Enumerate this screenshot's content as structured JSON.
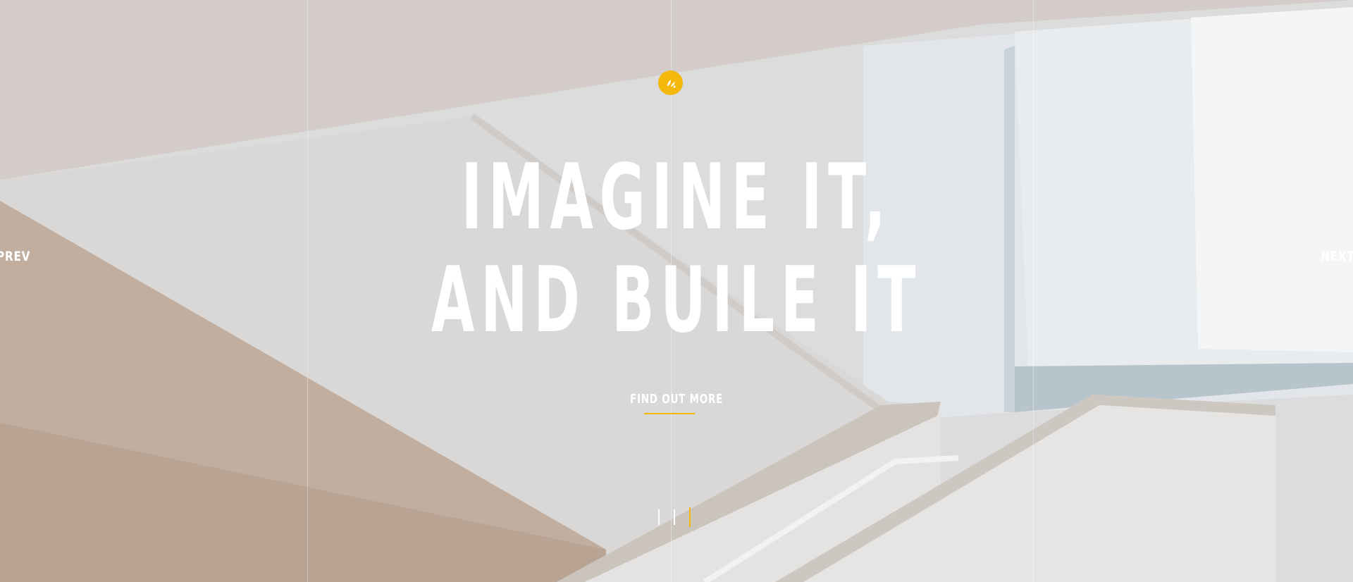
{
  "hero": {
    "headline_line1": "IMAGINE IT,",
    "headline_line2": "AND BUILE IT",
    "cta_label": "FIND OUT MORE"
  },
  "nav": {
    "prev_label": "PREV",
    "next_label": "NEXT"
  },
  "pager": {
    "total": 3,
    "active_index": 2
  },
  "colors": {
    "accent": "#f3b80b",
    "text": "#ffffff"
  },
  "icons": {
    "logo": "leaf-logo-icon"
  }
}
